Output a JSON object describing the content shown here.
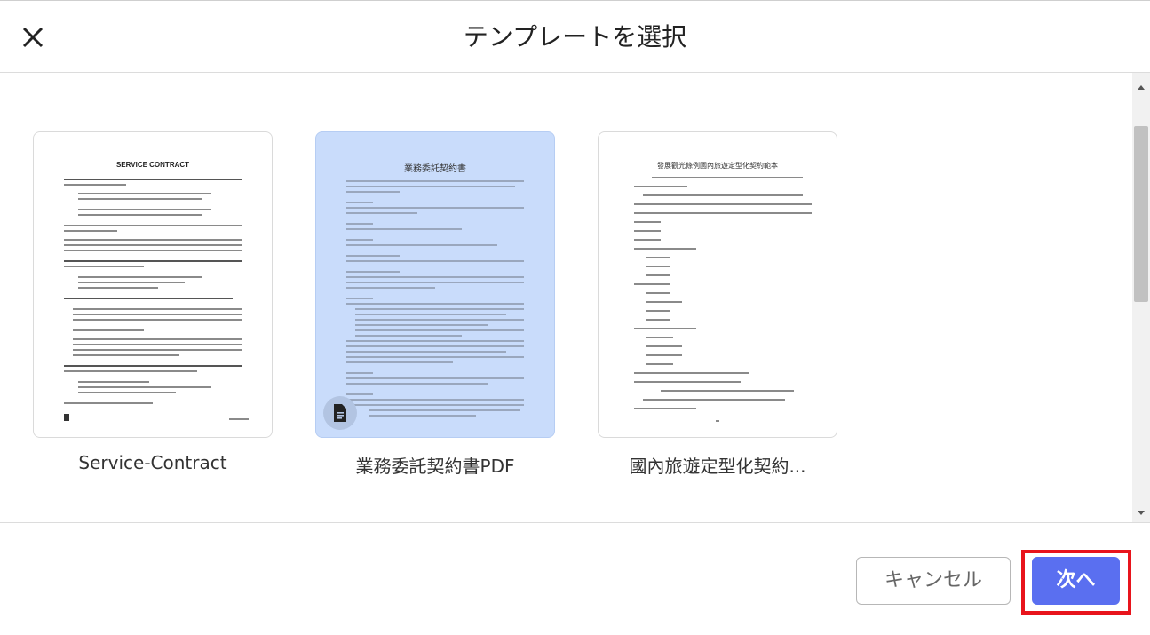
{
  "header": {
    "title": "テンプレートを選択",
    "close_icon": "close-icon"
  },
  "templates": [
    {
      "label": "Service-Contract",
      "selected": false,
      "thumb_title": "SERVICE CONTRACT"
    },
    {
      "label": "業務委託契約書PDF",
      "selected": true,
      "thumb_title": "業務委託契約書",
      "icon": "document-icon"
    },
    {
      "label": "國內旅遊定型化契約...",
      "selected": false,
      "thumb_title": "發展觀光條例國內旅遊定型化契約範本"
    }
  ],
  "footer": {
    "cancel_label": "キャンセル",
    "next_label": "次へ"
  },
  "colors": {
    "accent": "#5a6ff0",
    "selected_card": "#c9dcfb",
    "highlight": "#e8141c"
  }
}
